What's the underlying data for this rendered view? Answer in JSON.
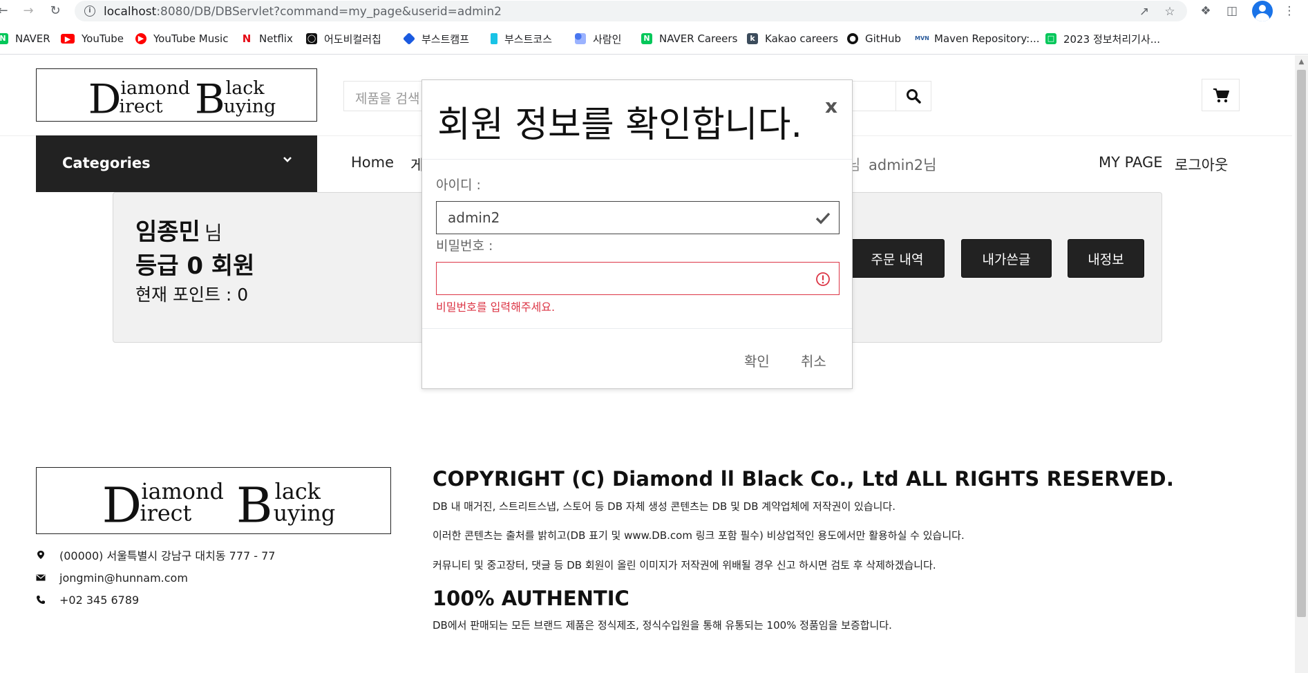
{
  "browser": {
    "url_host": "localhost",
    "url_path": ":8080/DB/DBServlet?command=my_page&userid=admin2",
    "bookmarks": [
      {
        "label": "NAVER",
        "icon": "naver-icon",
        "color": "#03c75a"
      },
      {
        "label": "YouTube",
        "icon": "youtube-icon",
        "color": "#ff0000"
      },
      {
        "label": "YouTube Music",
        "icon": "youtube-music-icon",
        "color": "#ff0000"
      },
      {
        "label": "Netflix",
        "icon": "netflix-icon",
        "color": "#e50914"
      },
      {
        "label": "어도비컬러칩",
        "icon": "adobe-color-icon",
        "color": "#111111"
      },
      {
        "label": "부스트캠프",
        "icon": "boostcamp-icon",
        "color": "#1a5ae0"
      },
      {
        "label": "부스트코스",
        "icon": "boostcourse-icon",
        "color": "#19c3e6"
      },
      {
        "label": "사람인",
        "icon": "saramin-icon",
        "color": "#4876ef"
      },
      {
        "label": "NAVER Careers",
        "icon": "naver-careers-icon",
        "color": "#03c75a"
      },
      {
        "label": "Kakao careers",
        "icon": "kakao-careers-icon",
        "color": "#3c4c5c"
      },
      {
        "label": "GitHub",
        "icon": "github-icon",
        "color": "#111111"
      },
      {
        "label": "Maven Repository:...",
        "icon": "maven-icon",
        "color": "#2c5c9c"
      },
      {
        "label": "2023 정보처리기사...",
        "icon": "bookmark-site-icon",
        "color": "#03c75a"
      }
    ]
  },
  "site": {
    "logo": {
      "line1_big": "D",
      "line1a": "iamond",
      "line1b_big": "B",
      "line1b": "lack",
      "line2a": "irect",
      "line2b": "uying"
    },
    "search_placeholder": "제품을 검색",
    "categories_label": "Categories",
    "menu": {
      "home": "Home",
      "board_partial": "게",
      "greeting_partial": "님",
      "user_greeting": "admin2님",
      "mypage": "MY PAGE",
      "logout": "로그아웃"
    }
  },
  "mypage": {
    "name": "임종민",
    "name_suffix": "님",
    "grade": "등급 0 회원",
    "points": "현재 포인트 : 0",
    "buttons": {
      "orders": "주문 내역",
      "my_posts": "내가쓴글",
      "my_info": "내정보"
    }
  },
  "modal": {
    "title": "회원 정보를 확인합니다.",
    "close": "x",
    "id_label": "아이디 :",
    "id_value": "admin2",
    "pw_label": "비밀번호 :",
    "pw_value": "",
    "pw_error": "비밀번호를 입력해주세요.",
    "confirm": "확인",
    "cancel": "취소"
  },
  "footer": {
    "address": "(00000) 서울특별시 강남구 대치동 777 - 77",
    "email": "jongmin@hunnam.com",
    "phone": "+02 345 6789",
    "copyright": "COPYRIGHT (C) Diamond ll Black Co., Ltd ALL RIGHTS RESERVED.",
    "notice1": "DB 내 매거진, 스트리트스냅, 스토어 등 DB 자체 생성 콘텐츠는 DB 및 DB 계약업체에 저작권이 있습니다.",
    "notice2": "이러한 콘텐츠는 출처를 밝히고(DB 표기 및 www.DB.com 링크 포함 필수) 비상업적인 용도에서만 활용하실 수 있습니다.",
    "notice3": "커뮤니티 및 중고장터, 댓글 등 DB 회원이 올린 이미지가 저작권에 위배될 경우 신고 하시면 검토 후 삭제하겠습니다.",
    "authentic_title": "100% AUTHENTIC",
    "authentic_text": "DB에서 판매되는 모든 브랜드 제품은 정식제조, 정식수입원을 통해 유통되는 100% 정품임을 보증합니다."
  }
}
